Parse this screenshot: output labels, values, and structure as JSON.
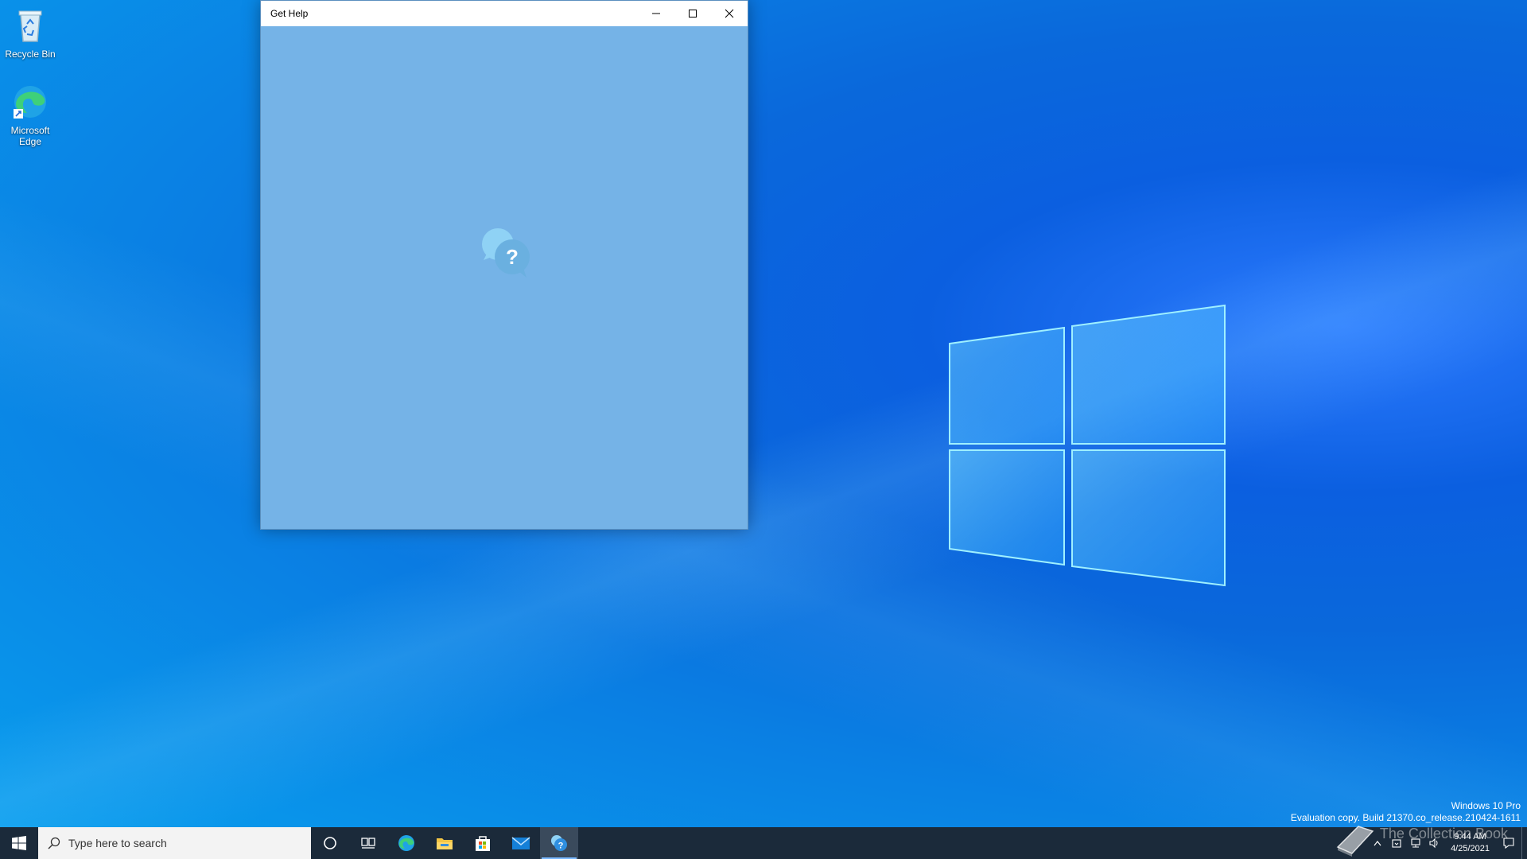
{
  "desktop": {
    "icons": [
      {
        "label": "Recycle Bin",
        "icon": "recycle-bin-icon"
      },
      {
        "label": "Microsoft Edge",
        "icon": "edge-icon"
      }
    ],
    "watermark": {
      "line1": "Windows 10 Pro",
      "line2": "Evaluation copy. Build 21370.co_release.210424-1611"
    },
    "overlay_text": "The Collection Book"
  },
  "window": {
    "title": "Get Help",
    "background": "#75b3e7",
    "splash_icon": "get-help-icon"
  },
  "taskbar": {
    "search_placeholder": "Type here to search",
    "pinned": [
      {
        "name": "cortana",
        "icon": "circle-icon"
      },
      {
        "name": "task-view",
        "icon": "task-view-icon"
      },
      {
        "name": "edge",
        "icon": "edge-icon"
      },
      {
        "name": "file-explorer",
        "icon": "folder-icon"
      },
      {
        "name": "store",
        "icon": "store-icon"
      },
      {
        "name": "mail",
        "icon": "mail-icon"
      },
      {
        "name": "get-help",
        "icon": "get-help-icon",
        "active": true
      }
    ],
    "clock": {
      "time": "9:44 AM",
      "date": "4/25/2021"
    },
    "accent": "#7ab8ff"
  }
}
